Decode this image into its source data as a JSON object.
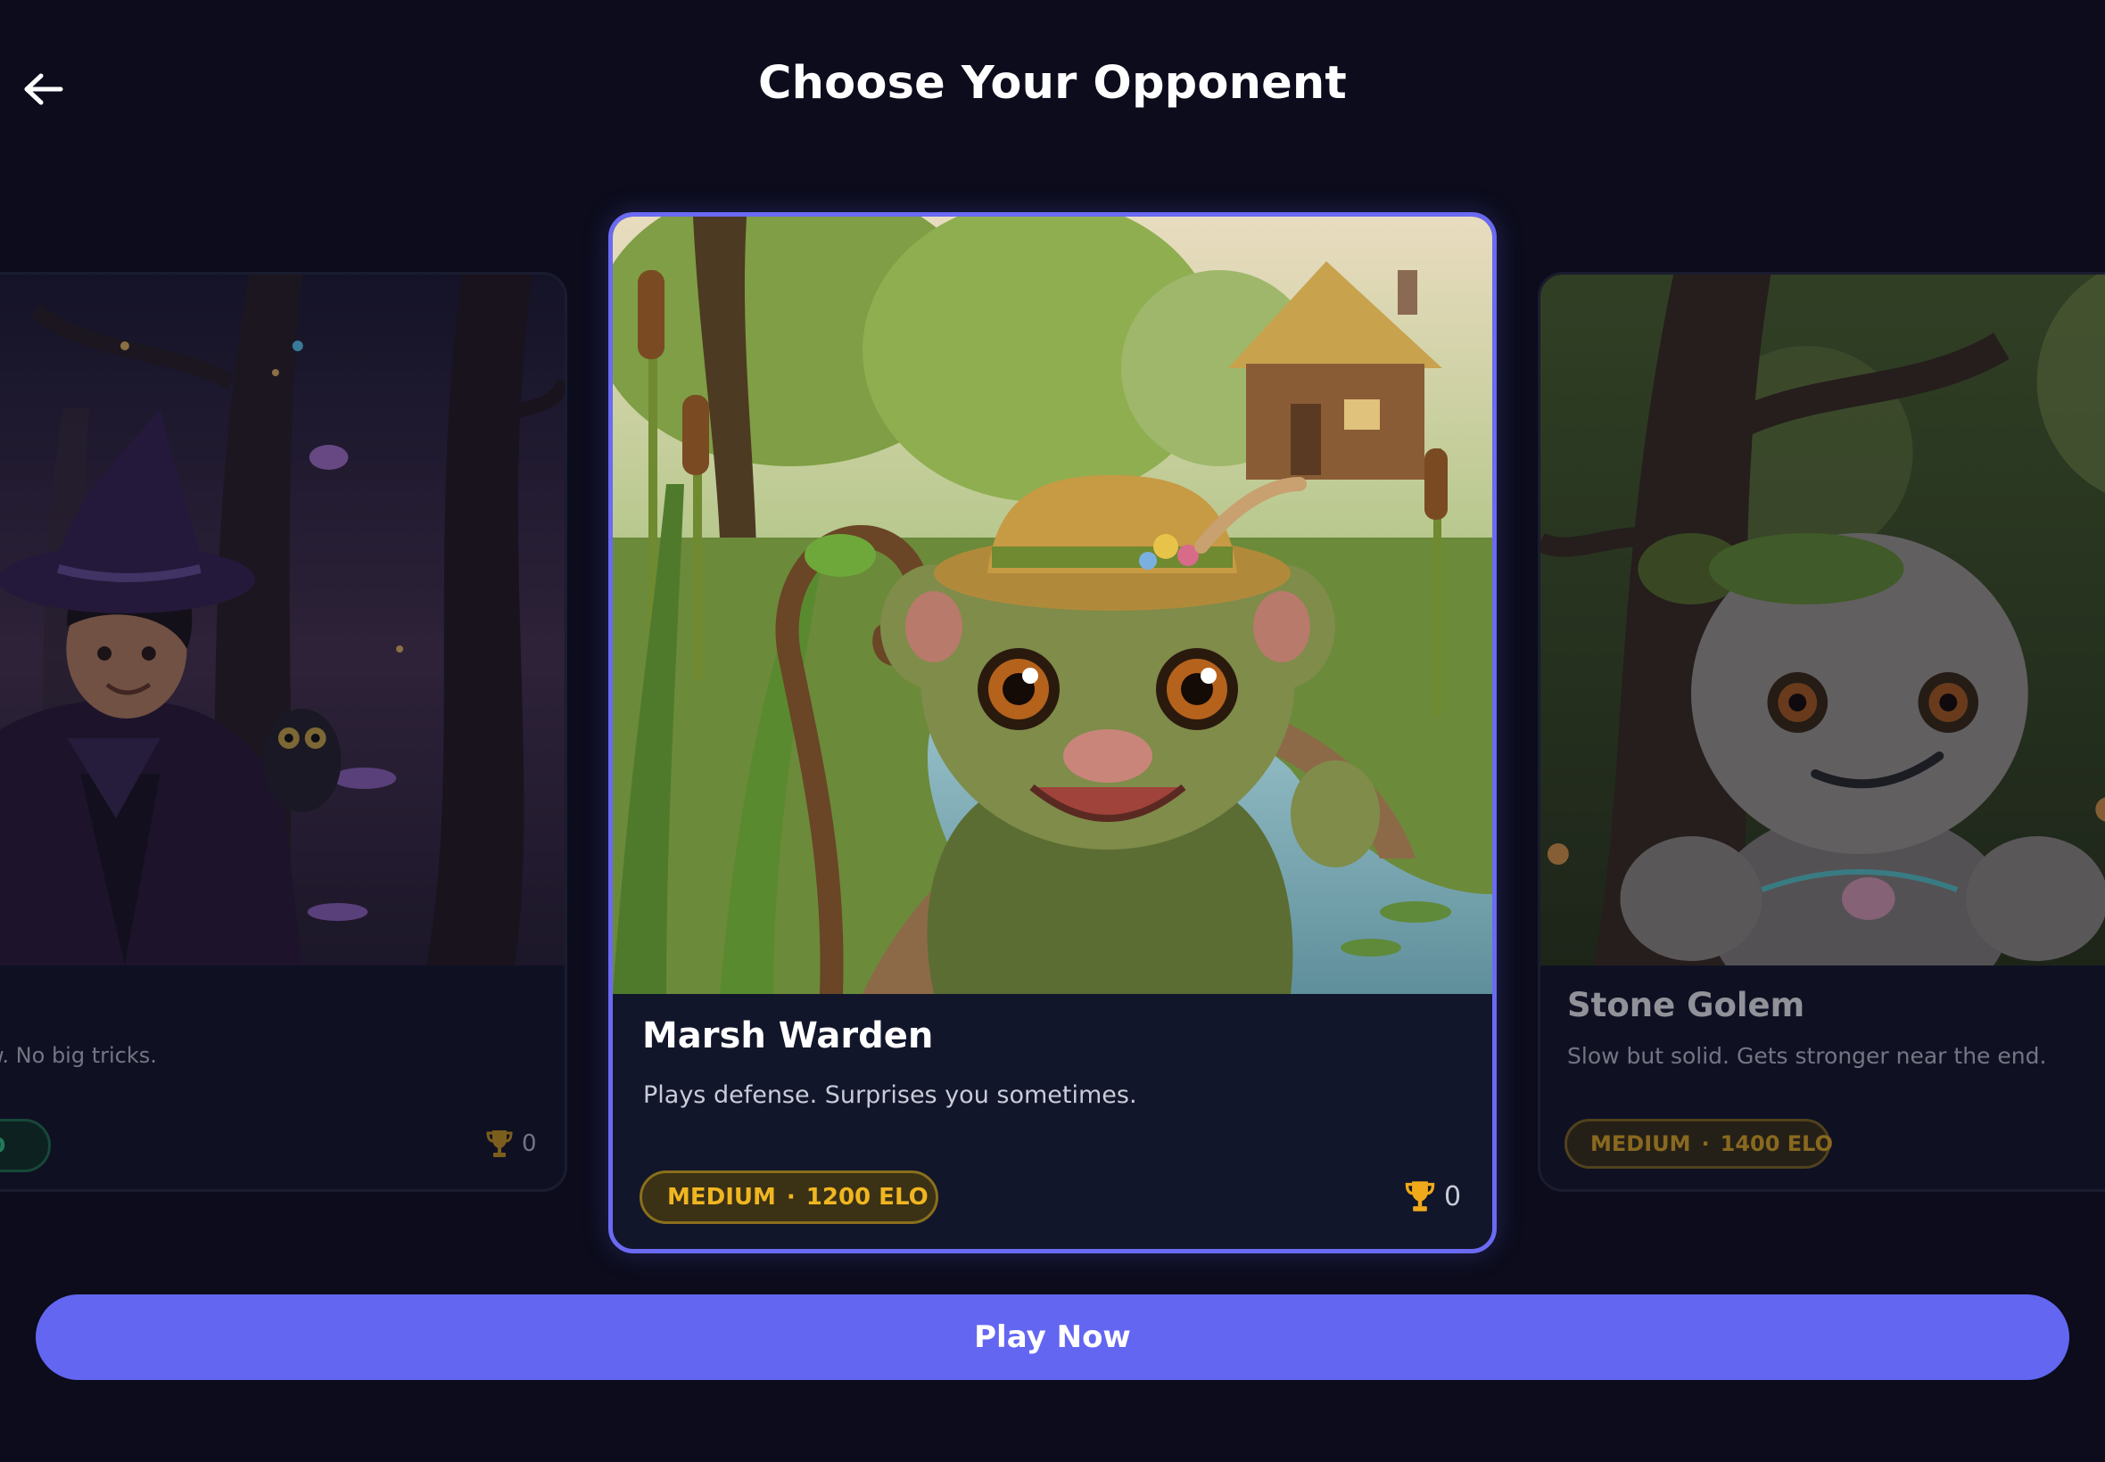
{
  "header": {
    "title": "Choose Your Opponent",
    "back_icon": "back-arrow-icon"
  },
  "opponents": [
    {
      "name": "",
      "description": "w. No big tricks.",
      "difficulty": "",
      "elo": "O",
      "trophies": "0",
      "badge_color": "#37d38a",
      "art": "wizard-with-owl-portrait"
    },
    {
      "name": "Marsh Warden",
      "description": "Plays defense. Surprises you sometimes.",
      "difficulty": "MEDIUM",
      "elo": "1200 ELO",
      "trophies": "0",
      "badge_color": "#f0b622",
      "art": "marsh-creature-portrait",
      "selected": true
    },
    {
      "name": "Stone Golem",
      "description": "Slow but solid. Gets stronger near the end.",
      "difficulty": "MEDIUM",
      "elo": "1400 ELO",
      "badge_color": "#f0b622",
      "art": "stone-golem-portrait"
    }
  ],
  "badge_separator": "·",
  "play_button": {
    "label": "Play Now"
  },
  "colors": {
    "background": "#0c0c1c",
    "card": "#12162a",
    "accent": "#6366f1",
    "medium": "#f0b622",
    "easy": "#37d38a"
  }
}
